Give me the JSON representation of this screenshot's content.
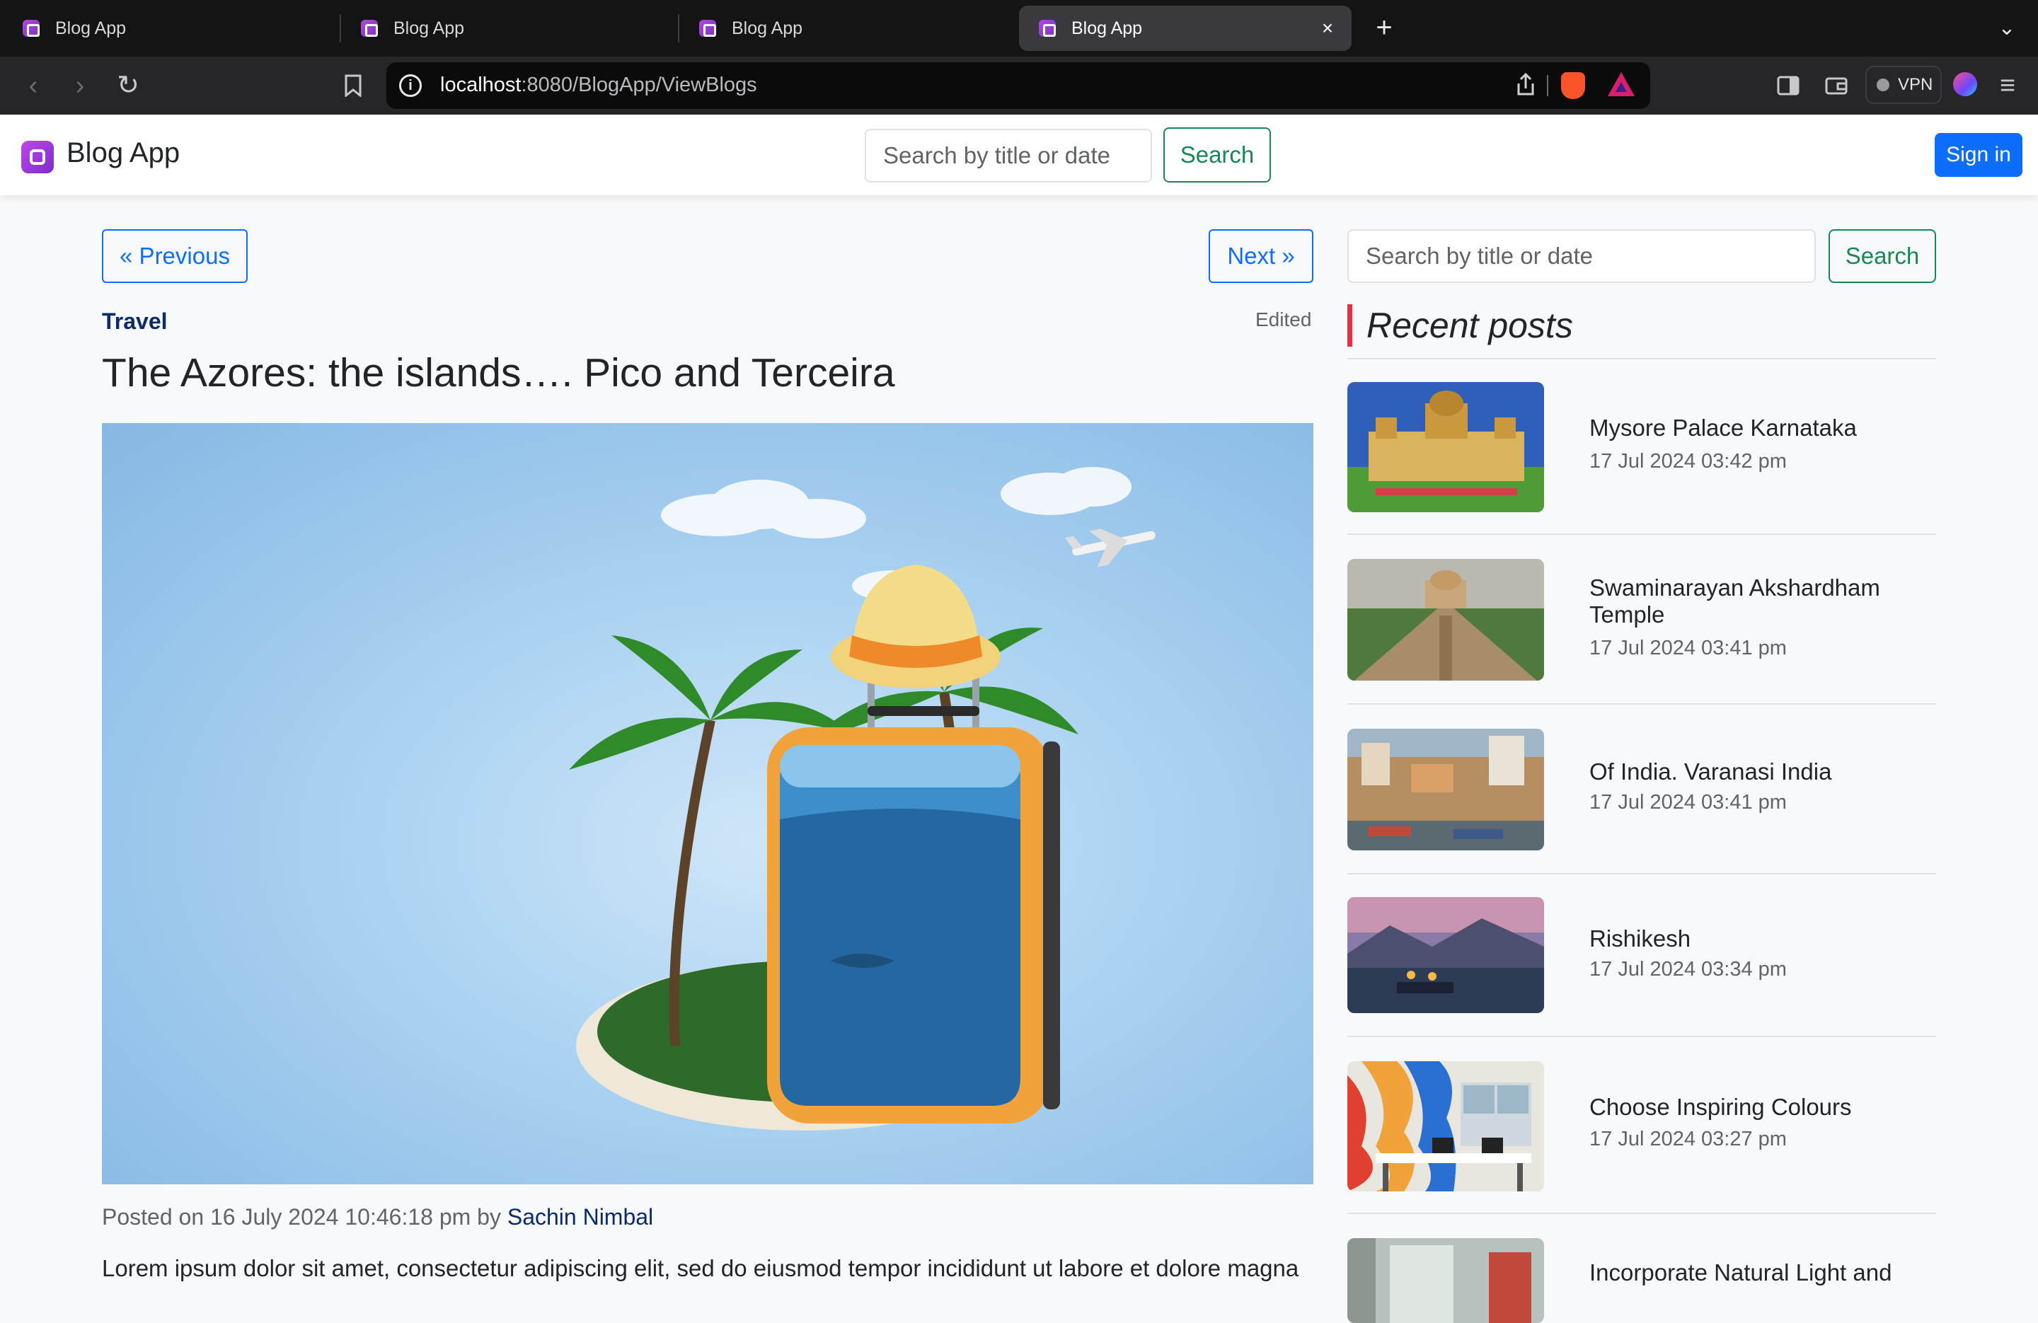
{
  "browser": {
    "tabs": [
      {
        "title": "Blog App",
        "active": false
      },
      {
        "title": "Blog App",
        "active": false
      },
      {
        "title": "Blog App",
        "active": false
      },
      {
        "title": "Blog App",
        "active": true
      }
    ],
    "url_host": "localhost",
    "url_path": ":8080/BlogApp/ViewBlogs",
    "vpn_label": "VPN"
  },
  "navbar": {
    "brand": "Blog App",
    "search_placeholder": "Search by title or date",
    "search_button": "Search",
    "signin_button": "Sign in"
  },
  "pager": {
    "previous": "« Previous",
    "next": "Next »"
  },
  "post": {
    "category": "Travel",
    "edited": "Edited",
    "title": "The Azores: the islands…. Pico and Terceira",
    "posted_prefix": "Posted on 16 July 2024 10:46:18 pm by ",
    "author": "Sachin Nimbal",
    "body_start": "Lorem ipsum dolor sit amet, consectetur adipiscing elit, sed do eiusmod tempor incididunt ut labore et dolore magna"
  },
  "sidebar": {
    "search_placeholder": "Search by title or date",
    "search_button": "Search",
    "heading": "Recent posts",
    "posts": [
      {
        "title": "Mysore Palace Karnataka",
        "date": "17 Jul 2024 03:42 pm"
      },
      {
        "title": "Swaminarayan Akshardham Temple",
        "date": "17 Jul 2024 03:41 pm"
      },
      {
        "title": "Of India. Varanasi India",
        "date": "17 Jul 2024 03:41 pm"
      },
      {
        "title": "Rishikesh",
        "date": "17 Jul 2024 03:34 pm"
      },
      {
        "title": "Choose Inspiring Colours",
        "date": "17 Jul 2024 03:27 pm"
      },
      {
        "title": "Incorporate Natural Light and",
        "date": ""
      }
    ]
  },
  "colors": {
    "primary": "#0d6efd",
    "success": "#198754",
    "accent_red": "#dc3545",
    "category_navy": "#0a2a6b"
  }
}
